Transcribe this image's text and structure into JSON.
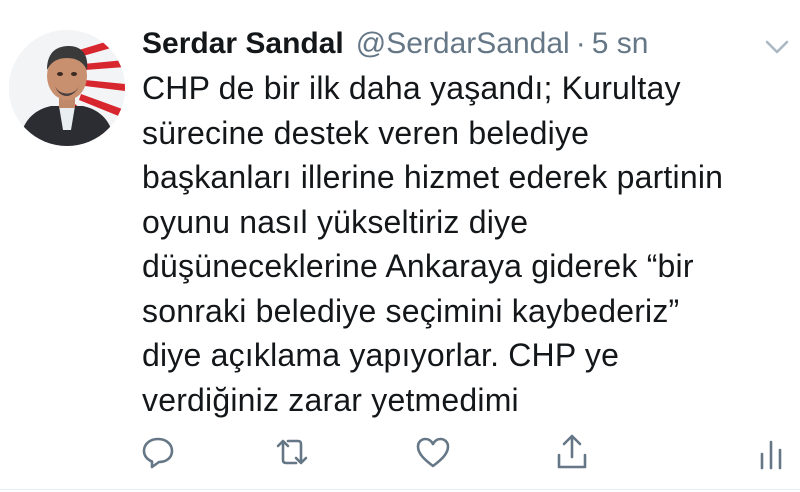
{
  "tweet": {
    "author": {
      "name": "Serdar Sandal",
      "handle": "@SerdarSandal",
      "separator": "·",
      "time": "5 sn"
    },
    "text_lines": [
      "CHP de bir ilk daha yaşandı; Kurultay",
      "sürecine destek veren belediye",
      "başkanları illerine hizmet ederek partinin",
      "oyunu nasıl yükseltiriz diye",
      "düşüneceklerine Ankaraya giderek “bir",
      "sonraki belediye seçimini kaybederiz”",
      "diye açıklama yapıyorlar. CHP ye",
      "verdiğiniz zarar yetmedimi"
    ],
    "actions": {
      "reply_icon": "reply-icon",
      "retweet_icon": "retweet-icon",
      "like_icon": "heart-icon",
      "share_icon": "share-icon",
      "analytics_icon": "analytics-icon"
    }
  },
  "colors": {
    "text": "#14171a",
    "secondary": "#657786",
    "icon": "#657786"
  }
}
